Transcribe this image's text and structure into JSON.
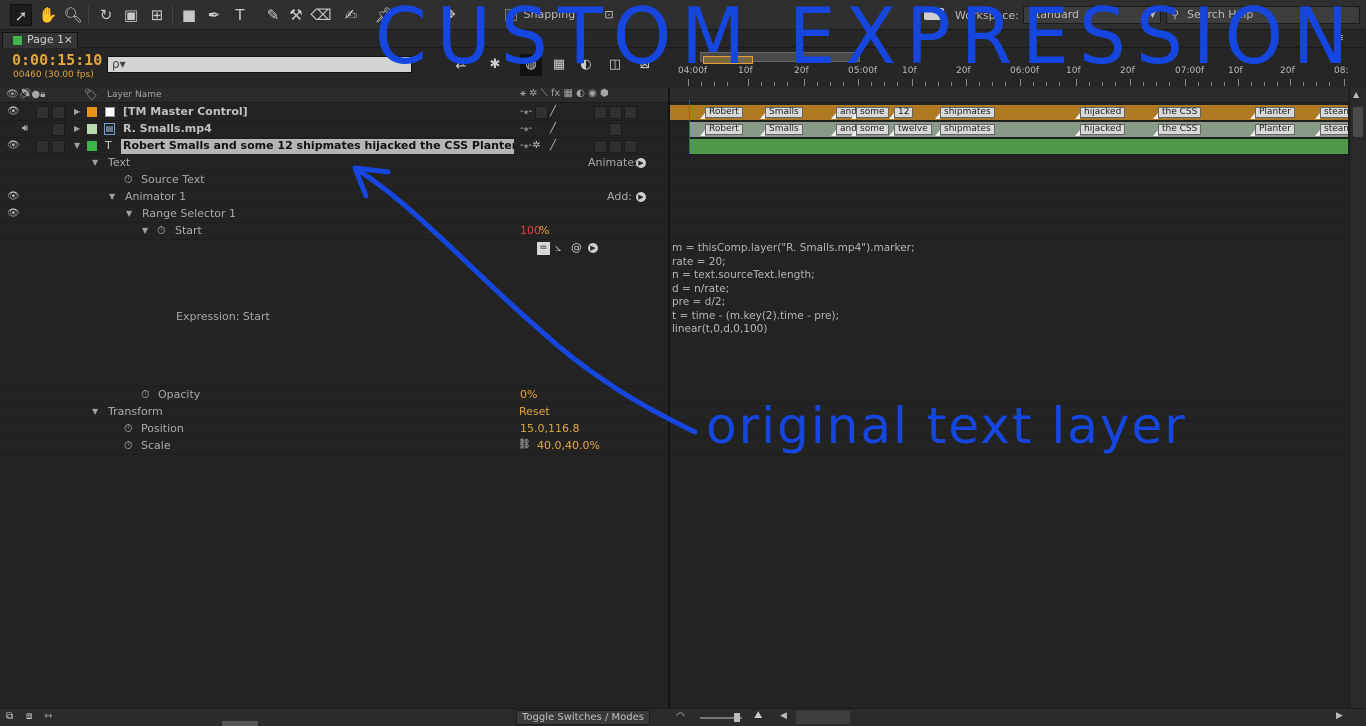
{
  "toolbar": {
    "snapping_label": "Snapping",
    "workspace_label": "Workspace:",
    "workspace_value": "Standard",
    "search_placeholder": "Search Help"
  },
  "tab": {
    "label": "Page 1",
    "close": "×",
    "menu": "≡"
  },
  "header": {
    "timecode": "0:00:15:10",
    "frame_fps": "00460 (30.00 fps)",
    "search_value": "ρ▾"
  },
  "ruler": {
    "ticks": [
      "04:00f",
      "10f",
      "20f",
      "05:00f",
      "10f",
      "20f",
      "06:00f",
      "10f",
      "20f",
      "07:00f",
      "10f",
      "20f",
      "08:00"
    ]
  },
  "columns": {
    "layer_name": "Layer Name"
  },
  "layers": [
    {
      "name": "[TM Master Control]",
      "color": "#e8911a"
    },
    {
      "name": "R. Smalls.mp4",
      "color": "#b9d9b0"
    },
    {
      "name": "Robert Smalls and some 12 shipmates hijacked the CSS Planter st",
      "color": "#3fb54a"
    }
  ],
  "properties": {
    "text": "Text",
    "animate": "Animate:",
    "source_text": "Source Text",
    "animator": "Animator 1",
    "add": "Add:",
    "range_selector": "Range Selector 1",
    "start": "Start",
    "start_value": "100",
    "start_unit": "%",
    "expression_label": "Expression: Start",
    "opacity": "Opacity",
    "opacity_value": "0%",
    "transform": "Transform",
    "reset": "Reset",
    "position": "Position",
    "position_value": "15.0,116.8",
    "scale": "Scale",
    "scale_value": "40.0,40.0%"
  },
  "expression_code": "m = thisComp.layer(\"R. Smalls.mp4\").marker;\nrate = 20;\nn = text.sourceText.length;\nd = n/rate;\npre = d/2;\nt = time - (m.key(2).time - pre);\nlinear(t,0,d,0,100)",
  "markers_row1": [
    "Robert",
    "Smalls",
    "and",
    "some",
    "12",
    "shipmates",
    "hijacked",
    "the CSS",
    "Planter",
    "steam"
  ],
  "markers_row2": [
    "Robert",
    "Smalls",
    "and",
    "some",
    "twelve",
    "shipmates",
    "hijacked",
    "the CSS",
    "Planter",
    "steam"
  ],
  "bottom": {
    "toggle_label": "Toggle Switches / Modes"
  },
  "annotations": {
    "title": "CUSTOM EXPRESSION",
    "subtitle": "original text layer"
  }
}
